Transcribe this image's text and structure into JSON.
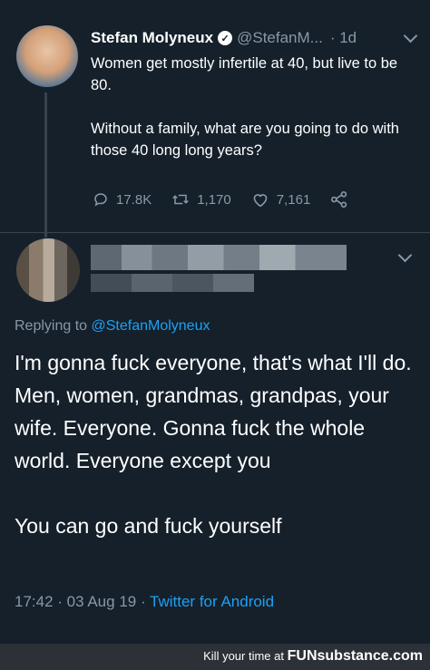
{
  "original_tweet": {
    "author_name": "Stefan Molyneux",
    "author_handle": "@StefanM...",
    "time_ago": "· 1d",
    "text": "Women get mostly infertile at 40, but live to be 80.\n\nWithout a family, what are you going to do with those 40 long long years?",
    "replies": "17.8K",
    "retweets": "1,170",
    "likes": "7,161"
  },
  "reply_tweet": {
    "replying_to_label": "Replying to",
    "replying_to_handle": "@StefanMolyneux",
    "text": "I'm gonna fuck everyone, that's what I'll do. Men, women, grandmas, grandpas, your wife. Everyone. Gonna fuck the whole world. Everyone except you\n\nYou can go and fuck yourself",
    "timestamp": "17:42 · 03 Aug 19 ·",
    "source": "Twitter for Android"
  },
  "watermark": {
    "label": "Kill your time at",
    "brand": "FUNsubstance.com"
  },
  "colors": {
    "background": "#15202b",
    "accent": "#1da1f2",
    "muted": "#8899a6"
  }
}
